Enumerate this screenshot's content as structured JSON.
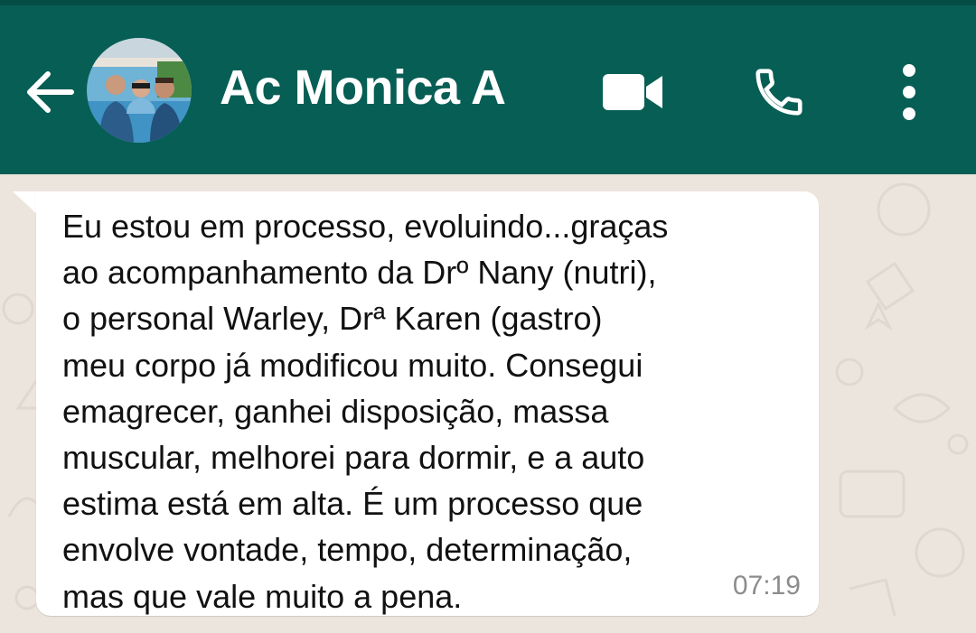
{
  "header": {
    "contact_name": "Ac Monica A",
    "icons": [
      "back-arrow-icon",
      "contact-avatar",
      "video-call-icon",
      "phone-icon",
      "more-options-icon"
    ]
  },
  "message": {
    "text": "Eu estou em processo, evoluindo...graças\nao acompanhamento da Drº Nany (nutri),\no personal Warley, Drª Karen (gastro)\nmeu corpo já modificou muito. Consegui\nemagrecer, ganhei disposição, massa\nmuscular, melhorei para dormir, e a auto\nestima está em alta. É um processo que\nenvolve vontade, tempo, determinação,\nmas que vale muito a pena.",
    "time": "07:19"
  },
  "colors": {
    "header_bg": "#075e54",
    "chat_bg": "#ece5dd",
    "bubble_bg": "#ffffff",
    "timestamp": "#8c8c8c"
  }
}
